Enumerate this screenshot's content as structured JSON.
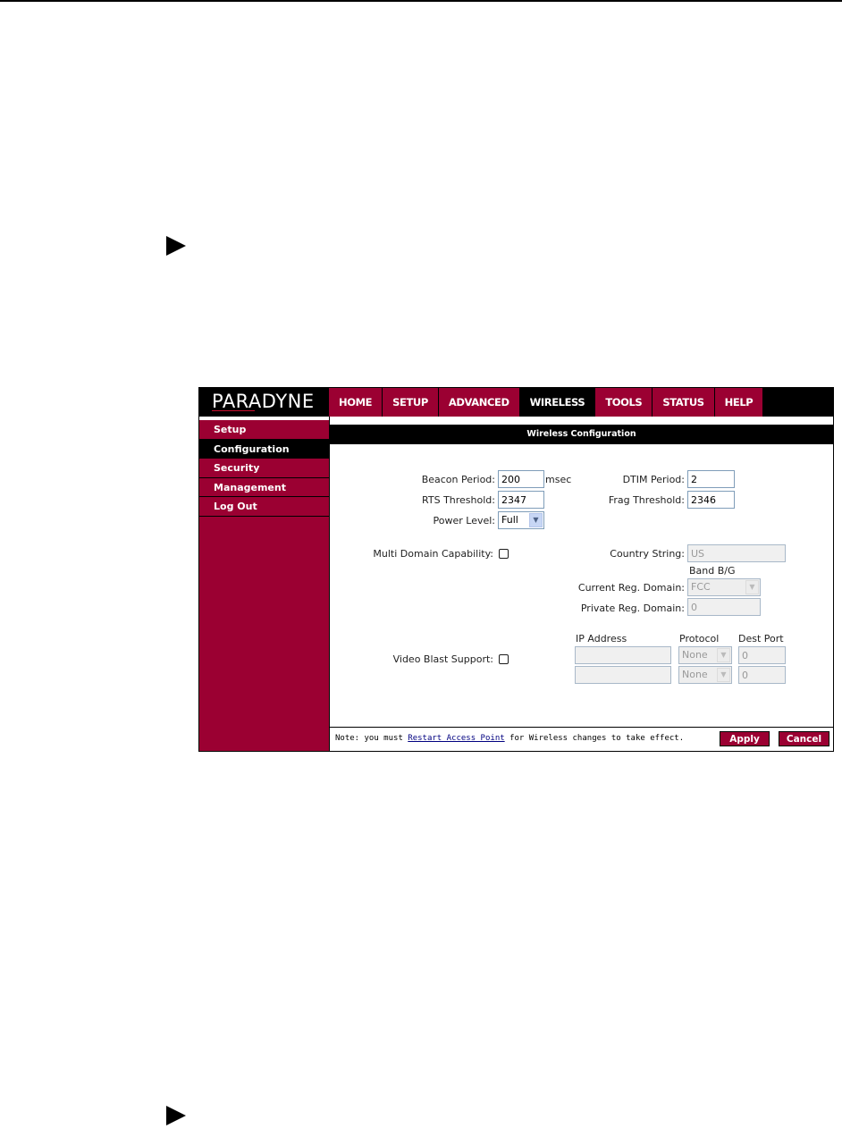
{
  "app": {
    "brand": "PARADYNE",
    "nav": [
      {
        "label": "HOME"
      },
      {
        "label": "SETUP"
      },
      {
        "label": "ADVANCED"
      },
      {
        "label": "WIRELESS",
        "active": true
      },
      {
        "label": "TOOLS"
      },
      {
        "label": "STATUS"
      },
      {
        "label": "HELP"
      }
    ],
    "sidebar": [
      {
        "label": "Setup"
      },
      {
        "label": "Configuration",
        "active": true
      },
      {
        "label": "Security"
      },
      {
        "label": "Management"
      },
      {
        "label": "Log Out"
      }
    ],
    "page_title": "Wireless Configuration",
    "form": {
      "beacon_period_label": "Beacon Period:",
      "beacon_period_value": "200",
      "beacon_period_unit": "msec",
      "dtim_period_label": "DTIM Period:",
      "dtim_period_value": "2",
      "rts_threshold_label": "RTS Threshold:",
      "rts_threshold_value": "2347",
      "frag_threshold_label": "Frag Threshold:",
      "frag_threshold_value": "2346",
      "power_level_label": "Power Level:",
      "power_level_value": "Full",
      "multi_domain_label": "Multi Domain Capability:",
      "country_string_label": "Country String:",
      "country_string_value": "US",
      "band_label": "Band B/G",
      "current_reg_domain_label": "Current Reg. Domain:",
      "current_reg_domain_value": "FCC",
      "private_reg_domain_label": "Private Reg. Domain:",
      "private_reg_domain_value": "0",
      "video_blast_label": "Video Blast Support:",
      "ip_address_header": "IP Address",
      "protocol_header": "Protocol",
      "dest_port_header": "Dest Port",
      "rows": [
        {
          "ip": "",
          "protocol": "None",
          "port": "0"
        },
        {
          "ip": "",
          "protocol": "None",
          "port": "0"
        }
      ]
    },
    "footer": {
      "note_prefix": "Note: you must ",
      "note_link": "Restart Access Point",
      "note_suffix": " for Wireless changes to take effect.",
      "apply_label": "Apply",
      "cancel_label": "Cancel"
    },
    "colors": {
      "brand_red": "#9b0032",
      "header_black": "#000000"
    }
  }
}
